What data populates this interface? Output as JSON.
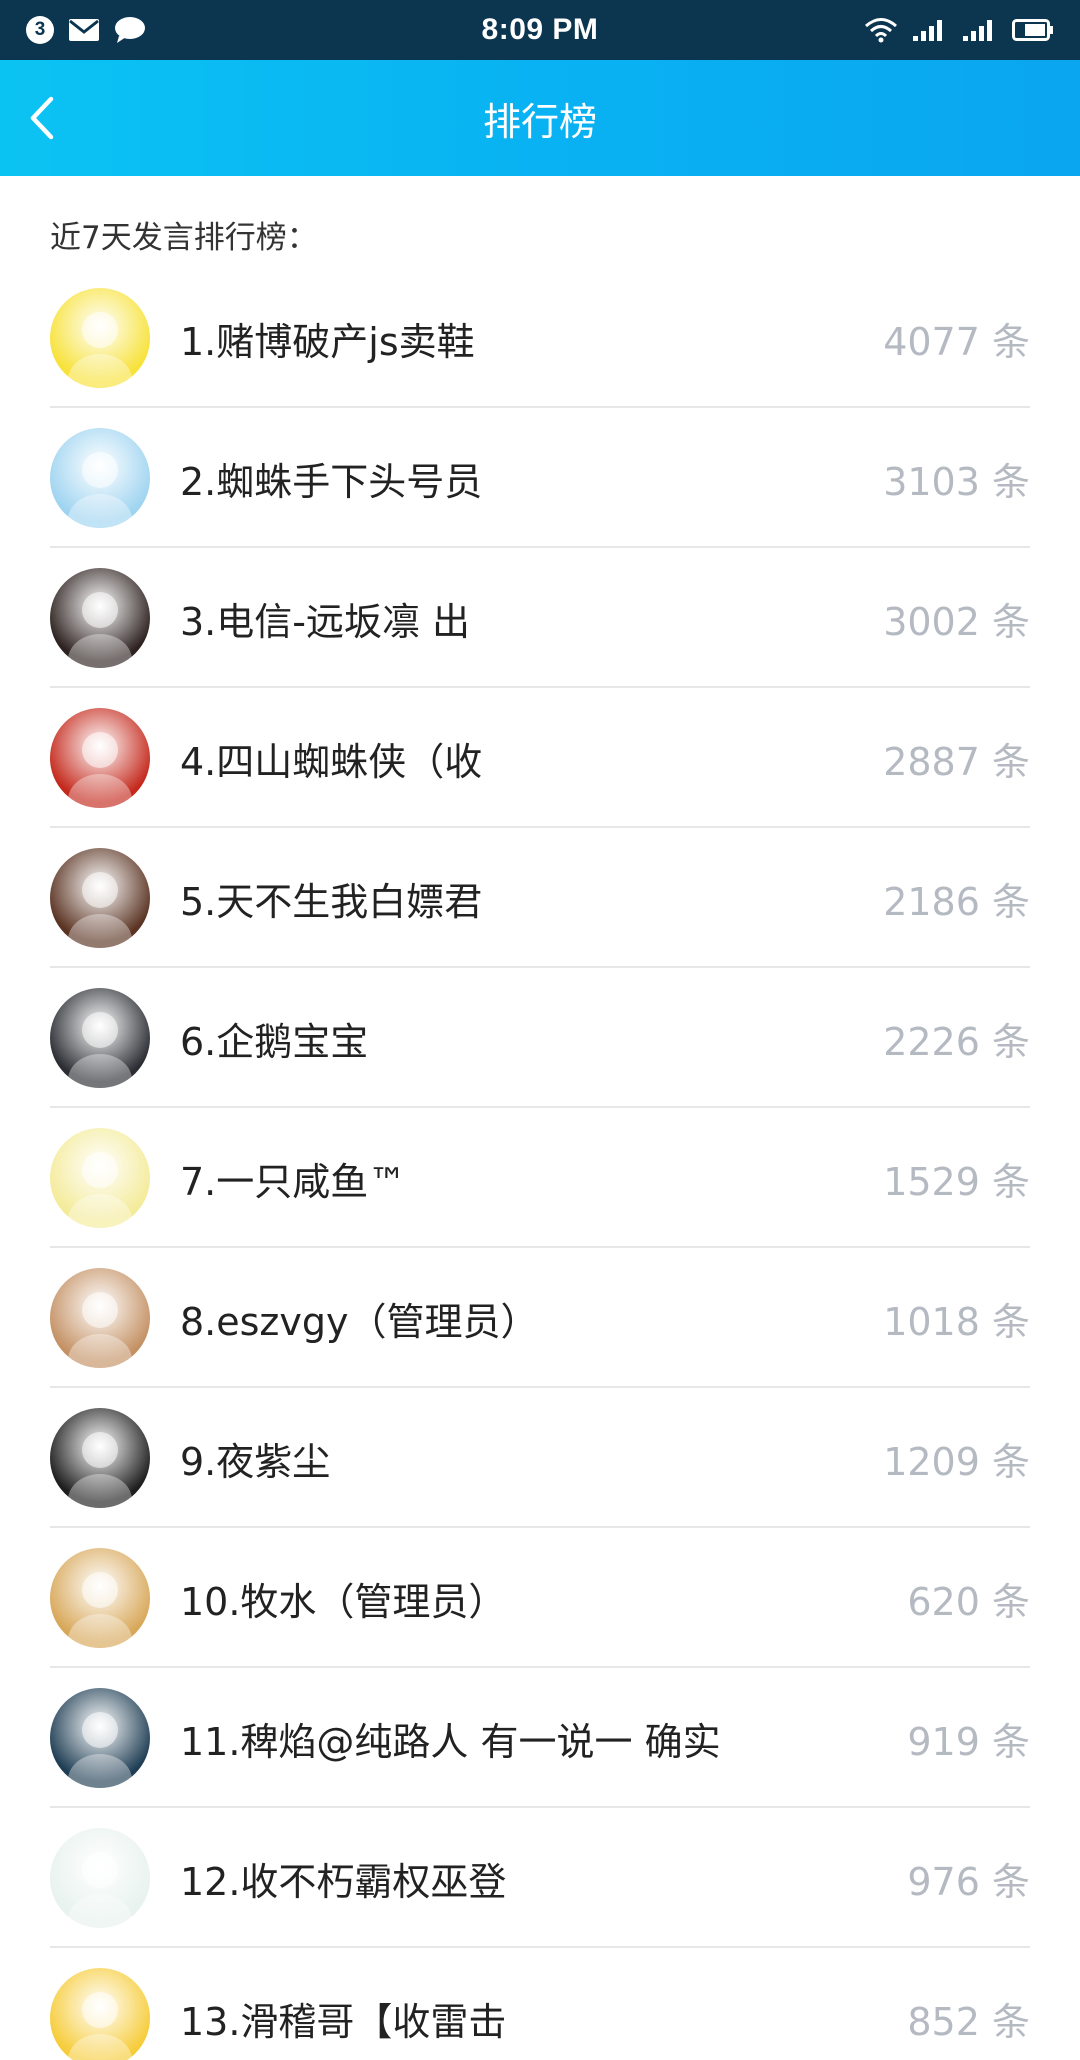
{
  "status_bar": {
    "notification_count": "3",
    "time": "8:09 PM",
    "sim2_label": "2"
  },
  "header": {
    "title": "排行榜"
  },
  "section": {
    "label": "近7天发言排行榜："
  },
  "rankings": [
    {
      "name": "1.赌博破产js卖鞋",
      "count": "4077 条",
      "avatar": "pikachu-avatar",
      "color": "#f7e23a"
    },
    {
      "name": "2.蜘蛛手下头号员",
      "count": "3103 条",
      "avatar": "anime-girl-avatar",
      "color": "#9fd4f1"
    },
    {
      "name": "3.电信-远坂凛 出",
      "count": "3002 条",
      "avatar": "anime-rin-avatar",
      "color": "#2d2220"
    },
    {
      "name": "4.四山蜘蛛侠（收",
      "count": "2887 条",
      "avatar": "spiderman-avatar",
      "color": "#c4291c"
    },
    {
      "name": "5.天不生我白嫖君",
      "count": "2186 条",
      "avatar": "woman-portrait-avatar",
      "color": "#5a3322"
    },
    {
      "name": "6.企鹅宝宝",
      "count": "2226 条",
      "avatar": "penguin-avatar",
      "color": "#2b2d33"
    },
    {
      "name": "7.一只咸鱼™",
      "count": "1529 条",
      "avatar": "salted-fish-avatar",
      "color": "#f4eb9a"
    },
    {
      "name": "8.eszvgy（管理员）",
      "count": "1018 条",
      "avatar": "cat-avatar",
      "color": "#c49164"
    },
    {
      "name": "9.夜紫尘",
      "count": "1209 条",
      "avatar": "mask-avatar",
      "color": "#1e1e1e"
    },
    {
      "name": "10.牧水（管理员）",
      "count": "620 条",
      "avatar": "anime-blonde-avatar",
      "color": "#d8a85a"
    },
    {
      "name": "11.稗焰@纯路人 有一说一 确实",
      "count": "919 条",
      "avatar": "anime-green-avatar",
      "color": "#1f3e54"
    },
    {
      "name": "12.收不朽霸权巫登",
      "count": "976 条",
      "avatar": "sketch-avatar",
      "color": "#e8f2ee"
    },
    {
      "name": "13.滑稽哥【收雷击",
      "count": "852 条",
      "avatar": "funny-face-avatar",
      "color": "#f6cc3a"
    }
  ]
}
